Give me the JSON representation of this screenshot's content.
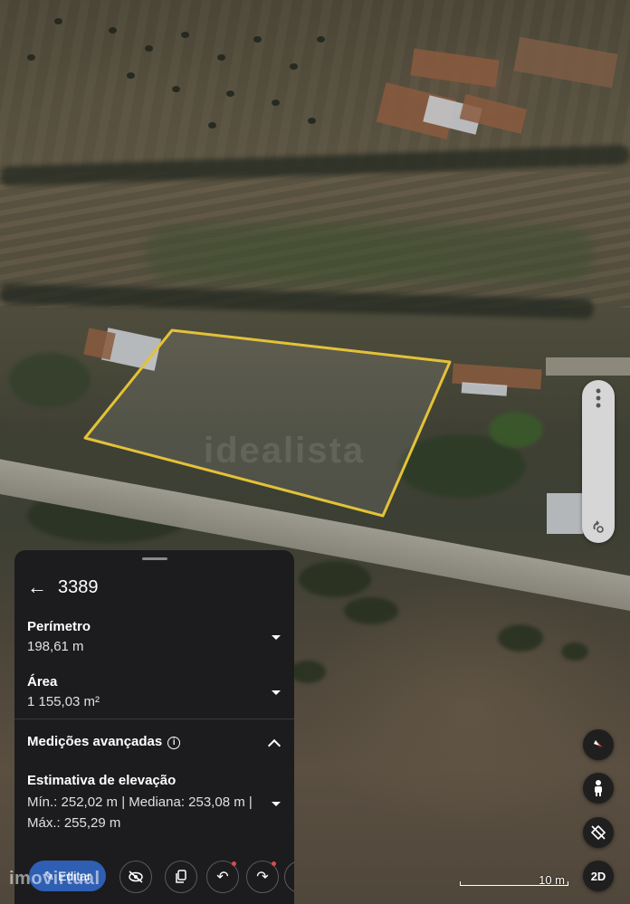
{
  "map": {
    "watermark_text": "idealista",
    "scale_label": "10 m",
    "plot_outline_color": "#e3c238"
  },
  "controls": {
    "side_menu_icon": "more-vertical-icon",
    "side_bottom_icon": "rotate-gesture-icon",
    "compass_icon": "compass-icon",
    "person_icon": "street-view-person-icon",
    "tilt_icon": "tilt-view-icon",
    "view_mode_label": "2D"
  },
  "panel": {
    "title": "3389",
    "back_icon": "back-arrow-icon",
    "perimeter": {
      "label": "Perímetro",
      "value": "198,61 m"
    },
    "area": {
      "label": "Área",
      "value": "1 155,03 m²"
    },
    "advanced": {
      "title": "Medições avançadas",
      "info_icon": "info-icon"
    },
    "elevation": {
      "label": "Estimativa de elevação",
      "text": "Mín.: 252,02 m | Mediana: 253,08 m | Máx.: 255,29 m"
    },
    "toolbar": {
      "edit_label": "Editar",
      "edit_icon": "pencil-icon",
      "hide_icon": "eye-off-icon",
      "copy_icon": "copy-icon",
      "undo_icon": "undo-icon",
      "redo_icon": "redo-icon"
    }
  },
  "overlay": {
    "watermark": "imovirtual"
  }
}
